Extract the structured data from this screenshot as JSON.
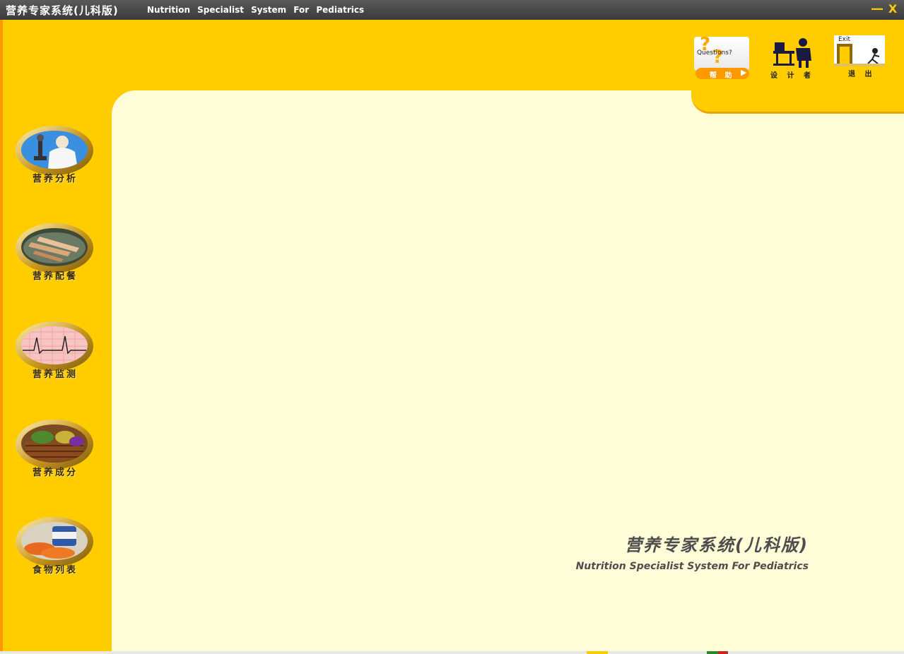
{
  "window": {
    "title_cn": "营养专家系统(儿科版)",
    "title_en": "Nutrition Specialist System For Pediatrics",
    "minimize_glyph": "—",
    "close_glyph": "X"
  },
  "top_buttons": {
    "help": {
      "card_text": "Questions?",
      "label": "帮 助",
      "icon": "question-icon"
    },
    "designer": {
      "label": "设 计 者",
      "icon": "designer-icon"
    },
    "exit": {
      "card_text": "Exit",
      "label": "退 出",
      "icon": "exit-door-icon"
    }
  },
  "sidebar": {
    "items": [
      {
        "label": "营养分析",
        "icon": "scientist-microscope-icon"
      },
      {
        "label": "营养配餐",
        "icon": "meal-plate-icon"
      },
      {
        "label": "营养监测",
        "icon": "heartbeat-monitor-icon"
      },
      {
        "label": "营养成分",
        "icon": "food-basket-icon"
      },
      {
        "label": "食物列表",
        "icon": "food-items-icon"
      }
    ]
  },
  "main": {
    "title_cn": "营养专家系统(儿科版)",
    "title_en": "Nutrition Specialist System For Pediatrics"
  },
  "colors": {
    "frame": "#ffcc00",
    "content_bg": "#fffcd8",
    "titlebar": "#444444",
    "accent": "#ff9900"
  }
}
